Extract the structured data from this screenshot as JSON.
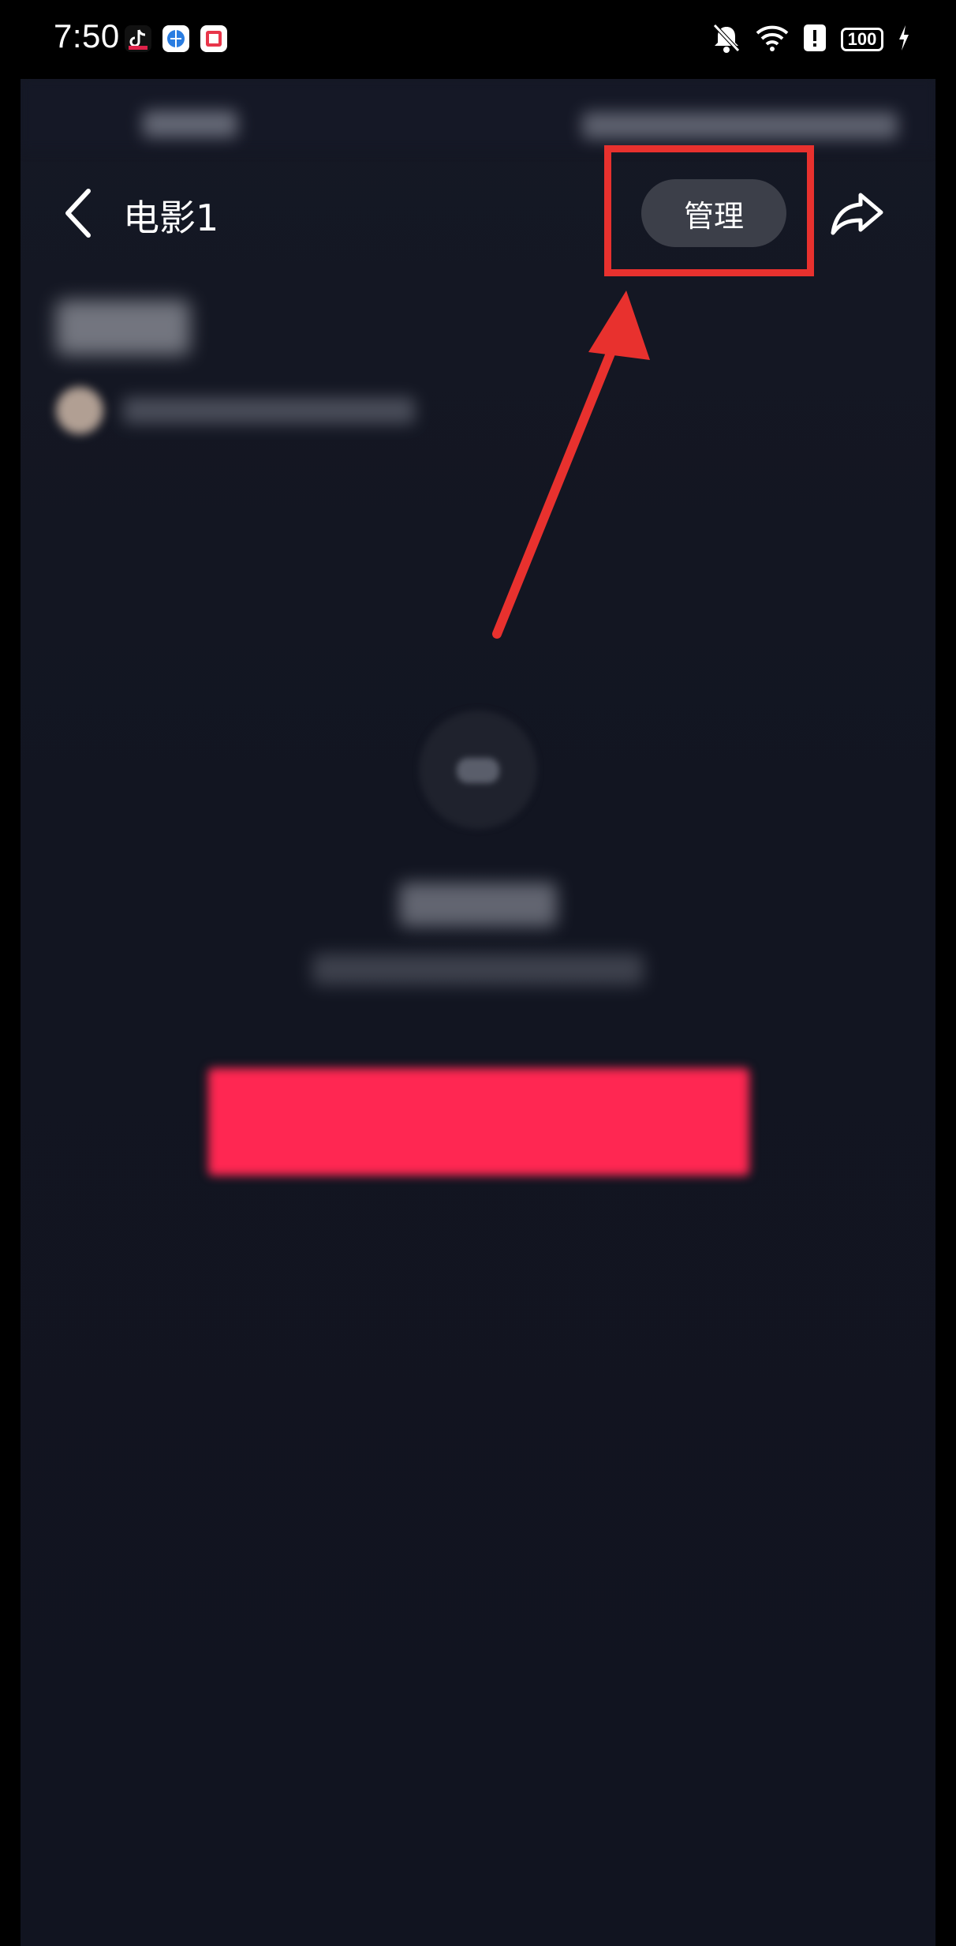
{
  "status_bar": {
    "time": "7:50",
    "battery": "100",
    "app_icons": [
      "tiktok-icon",
      "browser-icon",
      "notes-icon"
    ],
    "system_icons": [
      "bell-muted-icon",
      "wifi-icon",
      "alert-icon",
      "battery-icon",
      "charging-icon"
    ]
  },
  "header": {
    "title": "电影1",
    "manage_label": "管理",
    "back_icon": "chevron-left-icon",
    "share_icon": "share-arrow-icon"
  },
  "content": {
    "title": "电影1"
  },
  "annotation": {
    "highlight_color": "#e8312e",
    "arrow_color": "#e8312e"
  },
  "colors": {
    "background": "#121521",
    "cta": "#ff2752",
    "manage_bg": "#3c3f49"
  }
}
